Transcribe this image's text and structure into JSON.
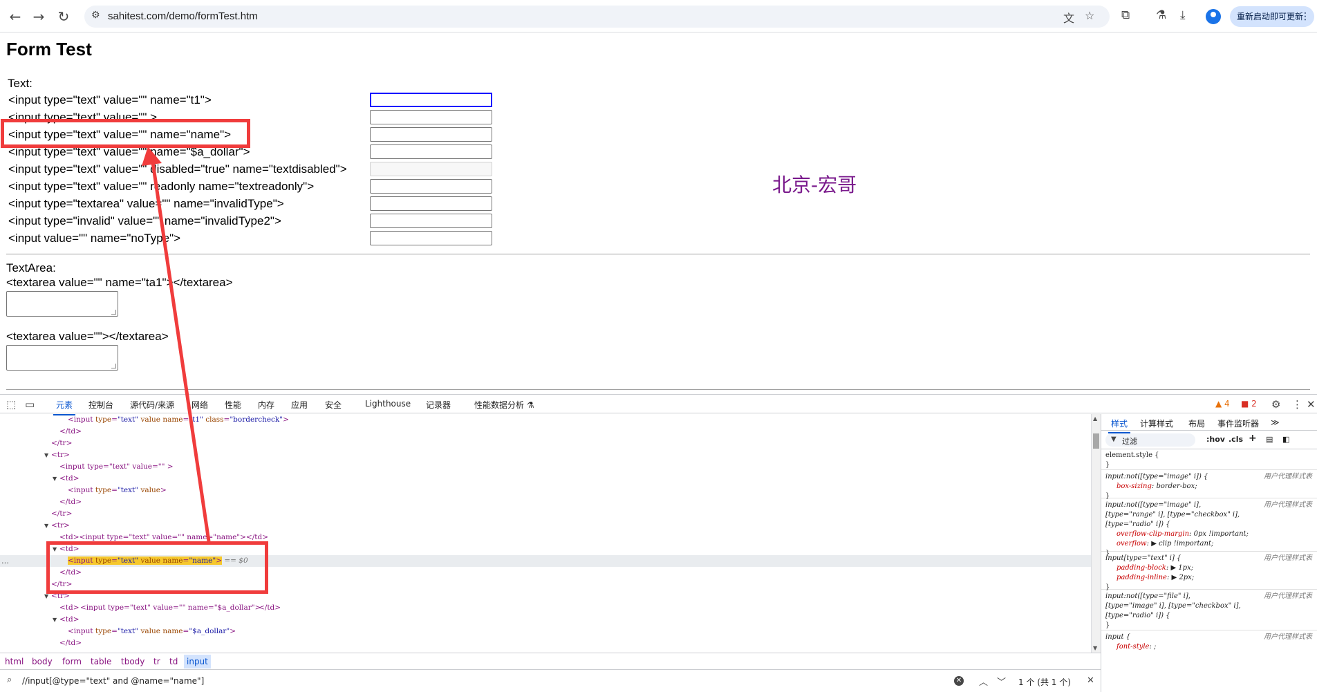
{
  "browser": {
    "url": "sahitest.com/demo/formTest.htm",
    "restart_label": "重新启动即可更新",
    "icons": {
      "back": "←",
      "forward": "→",
      "reload": "↻",
      "site_info": "⚙",
      "translate": "文",
      "star": "☆",
      "extensions": "⧉",
      "labs": "⚗",
      "download": "⤓",
      "menu": "⋮"
    }
  },
  "page": {
    "title": "Form Test",
    "text_label": "Text:",
    "rows": [
      "<input type=\"text\" value=\"\" name=\"t1\">",
      "<input type=\"text\" value=\"\" >",
      "<input type=\"text\" value=\"\" name=\"name\">",
      "<input type=\"text\" value=\"\" name=\"$a_dollar\">",
      "<input type=\"text\" value=\"\" disabled=\"true\" name=\"textdisabled\">",
      "<input type=\"text\" value=\"\" readonly name=\"textreadonly\">",
      "<input type=\"textarea\" value=\"\" name=\"invalidType\">",
      "<input type=\"invalid\" value=\"\" name=\"invalidType2\">",
      "<input value=\"\" name=\"noType\">"
    ],
    "textarea_label": "TextArea:",
    "textarea1_code": "<textarea value=\"\" name=\"ta1\"></textarea>",
    "textarea2_code": "<textarea value=\"\"></textarea>",
    "watermark": "北京-宏哥"
  },
  "devtools": {
    "tabs": [
      "元素",
      "控制台",
      "源代码/来源",
      "网络",
      "性能",
      "内存",
      "应用",
      "安全",
      "Lighthouse",
      "记录器",
      "性能数据分析 ⚗"
    ],
    "warnings": "4",
    "errors": "2",
    "dom": {
      "l1": {
        "tag_open": "<input",
        "a1": "type",
        "v1": "\"text\"",
        "a2": "value",
        "a3": "name",
        "v3": "\"t1\"",
        "a4": "class",
        "v4": "\"bordercheck\"",
        "close": ">"
      },
      "td_close": "</td>",
      "tr_close": "</tr>",
      "tr_open": "<tr>",
      "td_open": "<td>",
      "l4_text": "<input type=\"text\" value=\"\" >",
      "l6": {
        "tag_open": "<input",
        "a1": "type",
        "v1": "\"text\"",
        "a2": "value",
        "close": ">"
      },
      "l9_text": "<td><input type=\"text\" value=\"\" name=\"name\"></td>",
      "selected": {
        "tag_open": "<input",
        "a1": "type",
        "v1": "\"text\"",
        "a2": "value",
        "a3": "name",
        "v3": "\"name\"",
        "close": ">",
        "suffix": "== $0"
      },
      "l14_text": "<input type=\"text\" value=\"\" name=\"$a_dollar\">",
      "l16": {
        "tag_open": "<input",
        "a1": "type",
        "v1": "\"text\"",
        "a2": "value",
        "a3": "name",
        "v3": "\"$a_dollar\"",
        "close": ">"
      },
      "ellipsis": "…",
      "td_name_eq": "=\"\"",
      "td": "td",
      "eq": "="
    },
    "breadcrumbs": [
      "html",
      "body",
      "form",
      "table",
      "tbody",
      "tr",
      "td",
      "input"
    ],
    "search": {
      "query": "//input[@type=\"text\"  and @name=\"name\"]",
      "match_count": "1 个 (共 1 个)"
    },
    "styles": {
      "tabs": [
        "样式",
        "计算样式",
        "布局",
        "事件监听器",
        "≫"
      ],
      "filter_placeholder": "过滤",
      "hov": ":hov",
      "cls": ".cls",
      "origin": "用户代理样式表",
      "rules": [
        {
          "selector": "element.style {",
          "props": [],
          "close": "}"
        },
        {
          "selector": "input:not([type=\"image\" i]) {",
          "props": [
            {
              "name": "box-sizing",
              "value": "border-box;"
            }
          ],
          "close": "}"
        },
        {
          "selector": "input:not([type=\"image\" i],",
          "selector2": "[type=\"range\" i], [type=\"checkbox\" i],",
          "selector3": "[type=\"radio\" i]) {",
          "props": [
            {
              "name": "overflow-clip-margin",
              "value": "0px !important;"
            },
            {
              "name": "overflow",
              "value": "▶ clip !important;"
            }
          ],
          "close": "}"
        },
        {
          "selector": "input[type=\"text\" i] {",
          "props": [
            {
              "name": "padding-block",
              "value": "▶ 1px;"
            },
            {
              "name": "padding-inline",
              "value": "▶ 2px;"
            }
          ],
          "close": "}"
        },
        {
          "selector": "input:not([type=\"file\" i],",
          "selector2": "[type=\"image\" i], [type=\"checkbox\" i],",
          "selector3": "[type=\"radio\" i]) {",
          "props": [],
          "close": "}"
        },
        {
          "selector": "input {",
          "props": [
            {
              "name": "font-style",
              "value": ";"
            }
          ],
          "close": ""
        }
      ]
    }
  }
}
